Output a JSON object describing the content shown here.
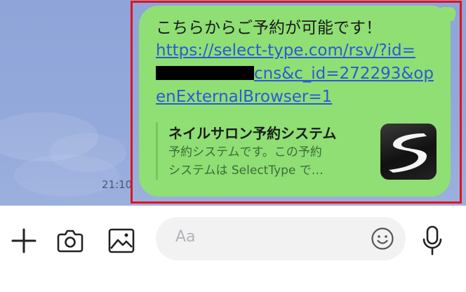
{
  "chat": {
    "timestamp": "21:10",
    "message": {
      "text": "こちらからご予約が可能です！",
      "link_part1": "https://select-type.com/rsv/?id=",
      "link_part2": "cns&c_id=272293&openExternalBrowser=1"
    },
    "link_preview": {
      "title": "ネイルサロン予約システム",
      "description_line1": "予約システムです。この予約",
      "description_line2": "システムは SelectType で…",
      "thumbnail": "select-type-logo"
    },
    "highlight_color": "#e0141e",
    "bubble_color": "#8fdf74"
  },
  "input_bar": {
    "placeholder": "Aa",
    "icons": {
      "plus": "plus-icon",
      "camera": "camera-icon",
      "image": "image-icon",
      "emoji": "emoji-icon",
      "mic": "microphone-icon"
    }
  }
}
